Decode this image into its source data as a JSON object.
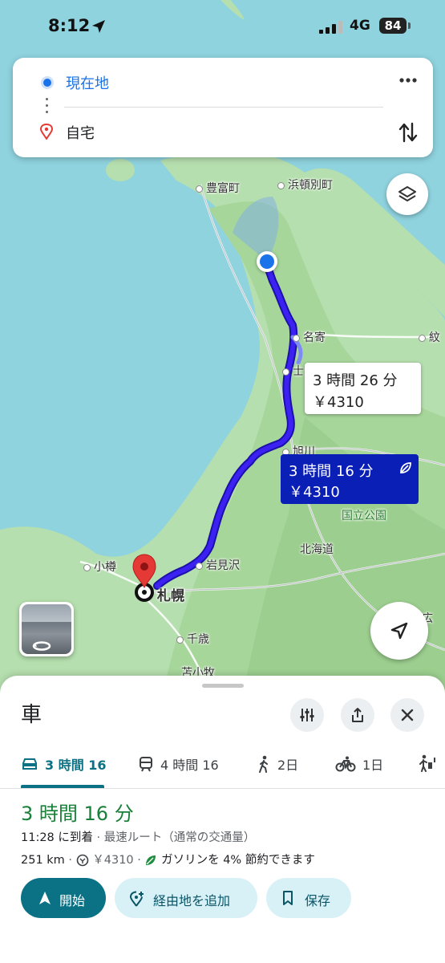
{
  "status_bar": {
    "time": "8:12",
    "network": "4G",
    "battery": "84"
  },
  "route_card": {
    "origin": "現在地",
    "destination": "自宅"
  },
  "map": {
    "labels": {
      "toyotomi": "豊富町",
      "hamatonbetsu": "浜頓別町",
      "nayoro": "名寄",
      "shibetsu": "士",
      "mombetsu": "紋",
      "asahikawa": "旭川",
      "national_park": "国立公園",
      "hokkaido": "北海道",
      "otaru": "小樽",
      "iwamizawa": "岩見沢",
      "sapporo": "札幌",
      "chitose": "千歳",
      "tomakomai": "苫小牧",
      "right_edge": "広"
    },
    "route_main": {
      "time": "3 時間 16 分",
      "toll": "￥4310"
    },
    "route_alt": {
      "time": "3 時間 26 分",
      "toll": "￥4310"
    },
    "route_color": "#2a1ad6",
    "origin_color": "#1a73e8",
    "destination_pin_color": "#e53935"
  },
  "sheet": {
    "mode_title": "車",
    "tabs": [
      {
        "label": "3 時間 16",
        "icon": "car-icon",
        "active": true
      },
      {
        "label": "4 時間 16",
        "icon": "train-icon",
        "active": false
      },
      {
        "label": "2日",
        "icon": "walk-icon",
        "active": false
      },
      {
        "label": "1日",
        "icon": "bike-icon",
        "active": false
      }
    ],
    "duration": "3 時間 16 分",
    "arrival_time": "11:28 に到着",
    "route_desc": " · 最速ルート（通常の交通量）",
    "distance": "251 km",
    "toll": "￥4310",
    "eco_note": "ガソリンを 4% 節約できます",
    "buttons": {
      "start": "開始",
      "add_waypoint": "経由地を追加",
      "save": "保存"
    },
    "accent_color": "#0b7285",
    "duration_color": "#188038"
  }
}
